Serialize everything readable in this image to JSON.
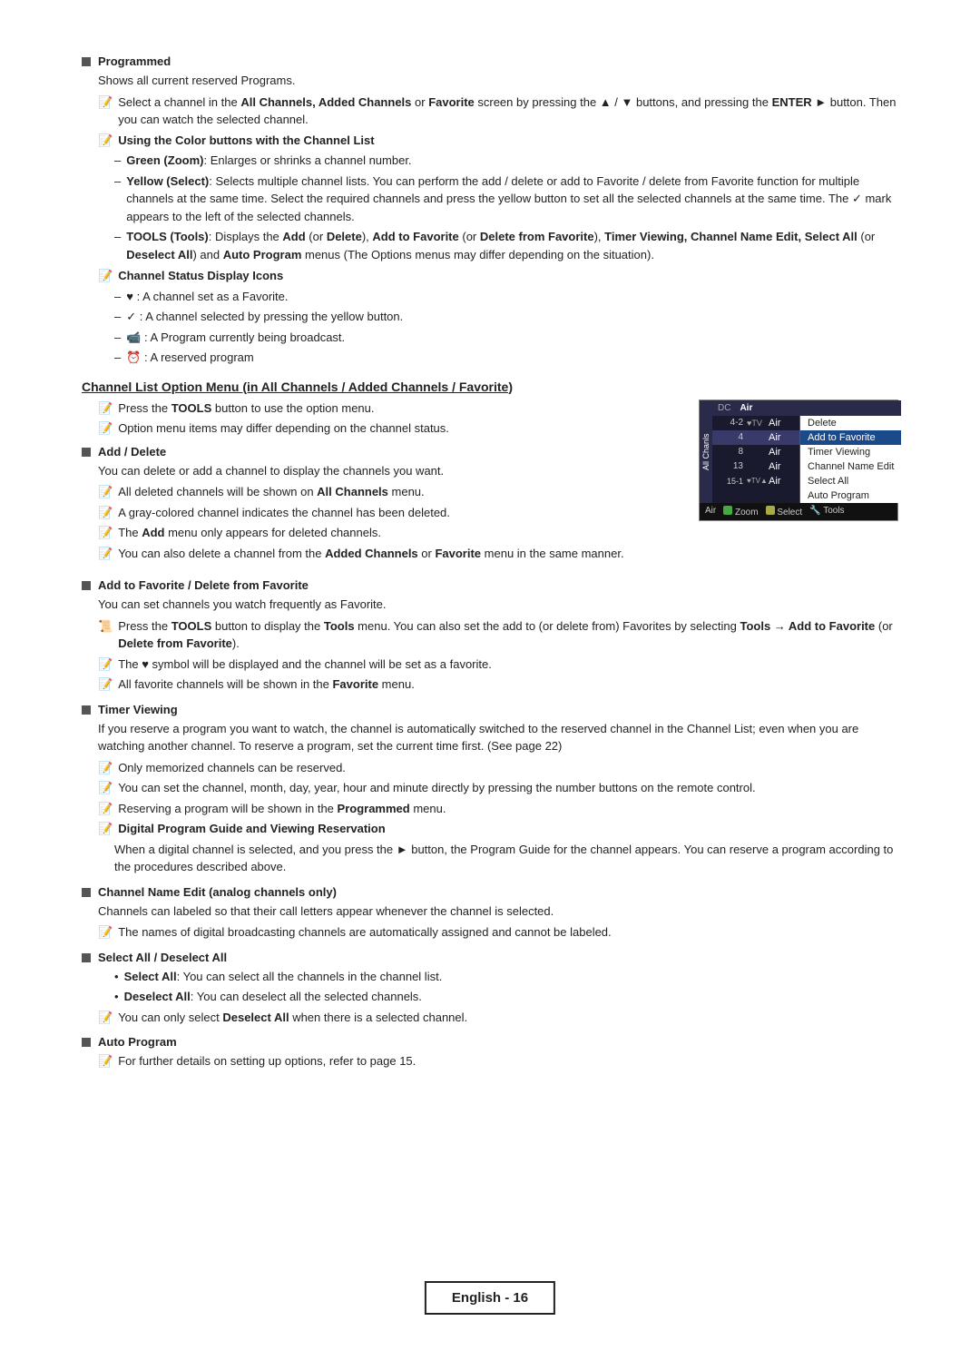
{
  "page": {
    "footer_label": "English - 16"
  },
  "sections": {
    "programmed": {
      "title": "Programmed",
      "body": "Shows all current reserved Programs.",
      "notes": [
        "Select a channel in the All Channels, Added Channels or Favorite screen by pressing the ▲ / ▼ buttons, and pressing the ENTER  button. Then you can watch the selected channel.",
        "Using the Color buttons with the Channel List"
      ],
      "color_bullets": [
        "Green (Zoom): Enlarges or shrinks a channel number.",
        "Yellow (Select): Selects multiple channel lists. You can perform the add / delete or add to Favorite / delete from Favorite function for multiple channels at the same time. Select the required channels and press the yellow button to set all the selected channels at the same time. The ✓ mark appears to the left of the selected channels.",
        "TOOLS (Tools): Displays the Add (or Delete), Add to Favorite (or Delete from Favorite), Timer Viewing, Channel Name Edit, Select All (or Deselect All) and Auto Program menus (The Options menus may differ depending on the situation)."
      ],
      "channel_status_title": "Channel Status Display Icons",
      "channel_status_items": [
        "♥ : A channel set as a Favorite.",
        "✓ : A channel selected by pressing the yellow button.",
        " : A Program currently being broadcast.",
        " : A reserved program"
      ]
    },
    "channel_list_option": {
      "title": "Channel List Option Menu (in All Channels / Added Channels / Favorite)",
      "notes": [
        "Press the TOOLS button to use the option menu.",
        "Option menu items may differ depending on the channel status."
      ]
    },
    "add_delete": {
      "title": "Add / Delete",
      "body": "You can delete or add a channel to display the channels you want.",
      "notes": [
        "All deleted channels will be shown on All Channels menu.",
        "A gray-colored channel indicates the channel has been deleted.",
        "The Add menu only appears for deleted channels.",
        "You can also delete a channel from the Added Channels or Favorite menu in the same manner."
      ]
    },
    "add_to_favorite": {
      "title": "Add to Favorite / Delete from Favorite",
      "body": "You can set channels you watch frequently as Favorite.",
      "notes": [
        "Press the TOOLS button to display the Tools menu. You can also set the add to (or delete from) Favorites by selecting Tools → Add to Favorite (or Delete from Favorite).",
        "The ♥ symbol will be displayed and the channel will be set as a favorite.",
        "All favorite channels will be shown in the Favorite menu."
      ]
    },
    "timer_viewing": {
      "title": "Timer Viewing",
      "body": "If you reserve a program you want to watch, the channel is automatically switched to the reserved channel in the Channel List; even when you are watching another channel. To reserve a program, set the current time first. (See page 22)",
      "notes": [
        "Only memorized channels can be reserved.",
        "You can set the channel, month, day, year, hour and minute directly by pressing the number buttons on the remote control.",
        "Reserving a program will be shown in the Programmed menu.",
        "Digital Program Guide and Viewing Reservation"
      ],
      "digital_guide_body": "When a digital channel is selected, and you press the ► button, the Program Guide for the channel appears. You can reserve a program according to the procedures described above."
    },
    "channel_name_edit": {
      "title": "Channel Name Edit (analog channels only)",
      "body": "Channels can labeled so that their call letters appear whenever the channel is selected.",
      "notes": [
        "The names of digital broadcasting channels are automatically assigned and cannot be labeled."
      ]
    },
    "select_all": {
      "title": "Select All / Deselect All",
      "bullets": [
        "Select All: You can select all the channels in the channel list.",
        "Deselect All: You can deselect all the selected channels."
      ],
      "notes": [
        "You can only select Deselect All when there is a selected channel."
      ]
    },
    "auto_program": {
      "title": "Auto Program",
      "notes": [
        "For further details on setting up options, refer to page 15."
      ]
    }
  },
  "tv_menu": {
    "tabs": [
      "All Chanls",
      "Air"
    ],
    "rows": [
      {
        "num": "4-2",
        "icons": "▼TV",
        "name": "Air",
        "selected": false
      },
      {
        "num": "4",
        "icons": "",
        "name": "Air",
        "selected": true
      },
      {
        "num": "8",
        "icons": "",
        "name": "Air",
        "selected": false
      },
      {
        "num": "13",
        "icons": "",
        "name": "Air",
        "selected": false
      },
      {
        "num": "15-1",
        "icons": "▼TV▲",
        "name": "Air",
        "selected": false
      }
    ],
    "options": [
      "Delete",
      "Add to Favorite",
      "Timer Viewing",
      "Channel Name Edit",
      "Select All",
      "Auto Program"
    ],
    "highlighted_option": "Add to Favorite",
    "footer": [
      "Air",
      "Zoom",
      "Select",
      "Tools"
    ]
  }
}
